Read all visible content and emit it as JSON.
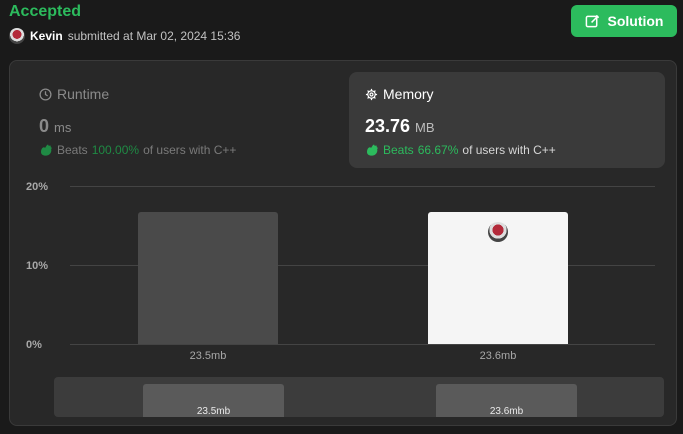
{
  "header": {
    "status": "Accepted",
    "user": "Kevin",
    "submitted_text": "submitted at Mar 02, 2024 15:36",
    "solution_label": "Solution"
  },
  "runtime": {
    "title": "Runtime",
    "value": "0",
    "unit": "ms",
    "beats_label": "Beats",
    "beats_pct": "100.00%",
    "beats_suffix": "of users with C++"
  },
  "memory": {
    "title": "Memory",
    "value": "23.76",
    "unit": "MB",
    "beats_label": "Beats",
    "beats_pct": "66.67%",
    "beats_suffix": "of users with C++"
  },
  "colors": {
    "accent": "#2cbb5d",
    "bar_default": "#4a4a4a",
    "bar_selected": "#f5f5f5"
  },
  "icons": [
    "clock-icon",
    "chip-icon",
    "clap-icon",
    "edit-icon",
    "avatar"
  ],
  "chart_data": {
    "type": "bar",
    "categories": [
      "23.5mb",
      "23.6mb"
    ],
    "values": [
      16.7,
      16.7
    ],
    "yticks": [
      "20%",
      "10%",
      "0%"
    ],
    "ylim": [
      0,
      20
    ],
    "selected_index": 1
  },
  "mini_chart": {
    "labels": [
      "23.5mb",
      "23.6mb"
    ]
  }
}
